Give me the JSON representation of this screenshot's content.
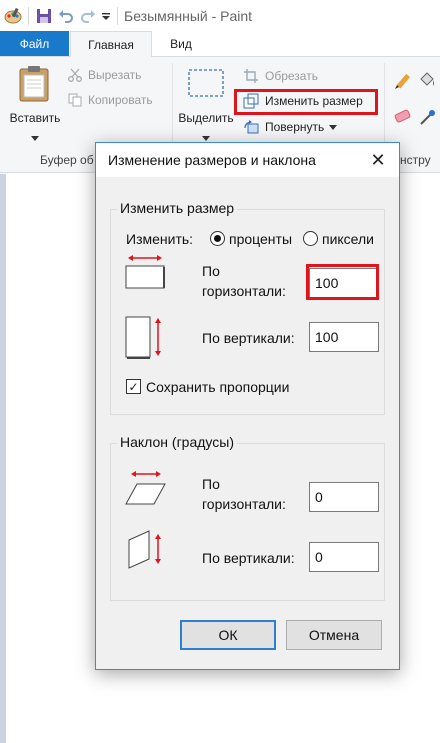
{
  "window": {
    "title": "Безымянный - Paint"
  },
  "tabs": {
    "file": "Файл",
    "home": "Главная",
    "view": "Вид"
  },
  "clipboard": {
    "paste": "Вставить",
    "cut": "Вырезать",
    "copy": "Копировать",
    "group_label": "Буфер об"
  },
  "image": {
    "select": "Выделить",
    "crop": "Обрезать",
    "resize": "Изменить размер",
    "rotate": "Повернуть",
    "group_label_partial": "нстру"
  },
  "dialog": {
    "title": "Изменение размеров и наклона",
    "close_glyph": "✕",
    "resize": {
      "legend": "Изменить размер",
      "by_label": "Изменить:",
      "option_percent": "проценты",
      "option_pixels": "пиксели",
      "selected": "percent",
      "horizontal_label_line1": "По",
      "horizontal_label_line2": "горизонтали:",
      "horizontal_value": "100",
      "vertical_label": "По вертикали:",
      "vertical_value": "100",
      "keep_ratio_label": "Сохранить пропорции",
      "keep_ratio_checked": true,
      "check_glyph": "✓"
    },
    "skew": {
      "legend": "Наклон (градусы)",
      "horizontal_label_line1": "По",
      "horizontal_label_line2": "горизонтали:",
      "horizontal_value": "0",
      "vertical_label": "По вертикали:",
      "vertical_value": "0"
    },
    "ok": "ОК",
    "cancel": "Отмена"
  },
  "colors": {
    "accent": "#1979ca",
    "highlight": "#e0151c",
    "dialog_border": "#3a8ad4"
  }
}
